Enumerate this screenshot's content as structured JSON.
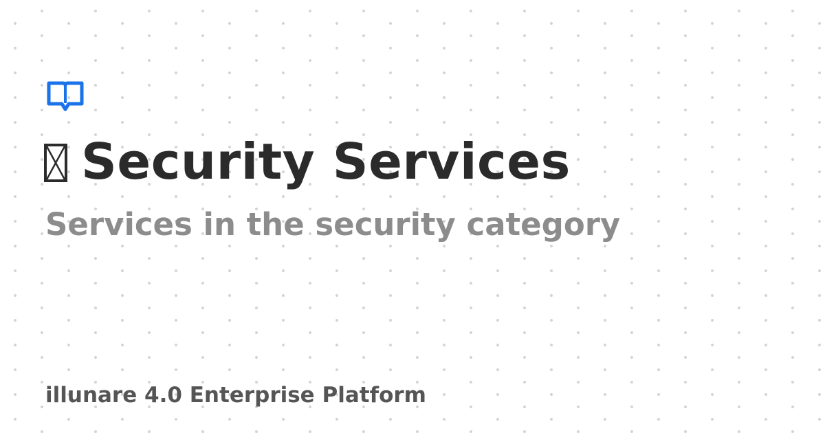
{
  "header": {
    "logo_icon": "book-chat-icon",
    "title_icon": "missing-glyph-icon",
    "title": "Security Services",
    "subtitle": "Services in the security category"
  },
  "footer": {
    "platform": "illunare 4.0 Enterprise Platform"
  },
  "colors": {
    "accent": "#1a73e8",
    "title": "#2b2b2b",
    "subtitle": "#8c8c8c",
    "footer": "#555555",
    "dots": "#d4d4d4"
  }
}
